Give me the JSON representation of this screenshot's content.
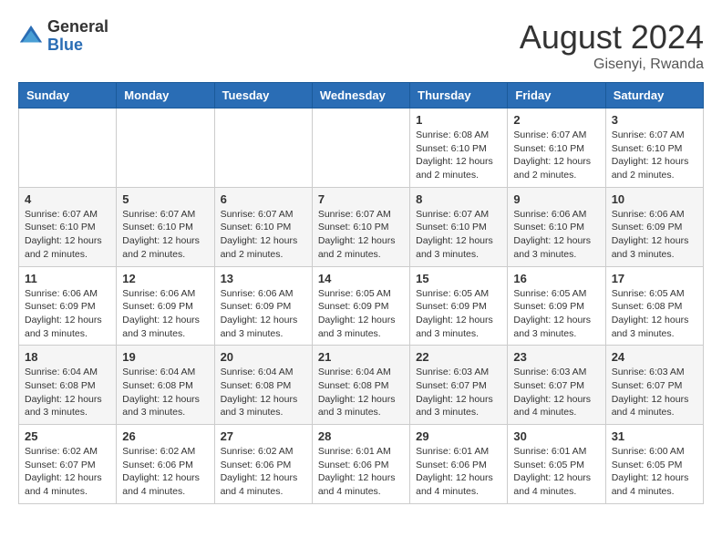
{
  "logo": {
    "general": "General",
    "blue": "Blue"
  },
  "title": "August 2024",
  "location": "Gisenyi, Rwanda",
  "days_of_week": [
    "Sunday",
    "Monday",
    "Tuesday",
    "Wednesday",
    "Thursday",
    "Friday",
    "Saturday"
  ],
  "weeks": [
    [
      {
        "day": "",
        "info": ""
      },
      {
        "day": "",
        "info": ""
      },
      {
        "day": "",
        "info": ""
      },
      {
        "day": "",
        "info": ""
      },
      {
        "day": "1",
        "info": "Sunrise: 6:08 AM\nSunset: 6:10 PM\nDaylight: 12 hours and 2 minutes."
      },
      {
        "day": "2",
        "info": "Sunrise: 6:07 AM\nSunset: 6:10 PM\nDaylight: 12 hours and 2 minutes."
      },
      {
        "day": "3",
        "info": "Sunrise: 6:07 AM\nSunset: 6:10 PM\nDaylight: 12 hours and 2 minutes."
      }
    ],
    [
      {
        "day": "4",
        "info": "Sunrise: 6:07 AM\nSunset: 6:10 PM\nDaylight: 12 hours and 2 minutes."
      },
      {
        "day": "5",
        "info": "Sunrise: 6:07 AM\nSunset: 6:10 PM\nDaylight: 12 hours and 2 minutes."
      },
      {
        "day": "6",
        "info": "Sunrise: 6:07 AM\nSunset: 6:10 PM\nDaylight: 12 hours and 2 minutes."
      },
      {
        "day": "7",
        "info": "Sunrise: 6:07 AM\nSunset: 6:10 PM\nDaylight: 12 hours and 2 minutes."
      },
      {
        "day": "8",
        "info": "Sunrise: 6:07 AM\nSunset: 6:10 PM\nDaylight: 12 hours and 3 minutes."
      },
      {
        "day": "9",
        "info": "Sunrise: 6:06 AM\nSunset: 6:10 PM\nDaylight: 12 hours and 3 minutes."
      },
      {
        "day": "10",
        "info": "Sunrise: 6:06 AM\nSunset: 6:09 PM\nDaylight: 12 hours and 3 minutes."
      }
    ],
    [
      {
        "day": "11",
        "info": "Sunrise: 6:06 AM\nSunset: 6:09 PM\nDaylight: 12 hours and 3 minutes."
      },
      {
        "day": "12",
        "info": "Sunrise: 6:06 AM\nSunset: 6:09 PM\nDaylight: 12 hours and 3 minutes."
      },
      {
        "day": "13",
        "info": "Sunrise: 6:06 AM\nSunset: 6:09 PM\nDaylight: 12 hours and 3 minutes."
      },
      {
        "day": "14",
        "info": "Sunrise: 6:05 AM\nSunset: 6:09 PM\nDaylight: 12 hours and 3 minutes."
      },
      {
        "day": "15",
        "info": "Sunrise: 6:05 AM\nSunset: 6:09 PM\nDaylight: 12 hours and 3 minutes."
      },
      {
        "day": "16",
        "info": "Sunrise: 6:05 AM\nSunset: 6:09 PM\nDaylight: 12 hours and 3 minutes."
      },
      {
        "day": "17",
        "info": "Sunrise: 6:05 AM\nSunset: 6:08 PM\nDaylight: 12 hours and 3 minutes."
      }
    ],
    [
      {
        "day": "18",
        "info": "Sunrise: 6:04 AM\nSunset: 6:08 PM\nDaylight: 12 hours and 3 minutes."
      },
      {
        "day": "19",
        "info": "Sunrise: 6:04 AM\nSunset: 6:08 PM\nDaylight: 12 hours and 3 minutes."
      },
      {
        "day": "20",
        "info": "Sunrise: 6:04 AM\nSunset: 6:08 PM\nDaylight: 12 hours and 3 minutes."
      },
      {
        "day": "21",
        "info": "Sunrise: 6:04 AM\nSunset: 6:08 PM\nDaylight: 12 hours and 3 minutes."
      },
      {
        "day": "22",
        "info": "Sunrise: 6:03 AM\nSunset: 6:07 PM\nDaylight: 12 hours and 3 minutes."
      },
      {
        "day": "23",
        "info": "Sunrise: 6:03 AM\nSunset: 6:07 PM\nDaylight: 12 hours and 4 minutes."
      },
      {
        "day": "24",
        "info": "Sunrise: 6:03 AM\nSunset: 6:07 PM\nDaylight: 12 hours and 4 minutes."
      }
    ],
    [
      {
        "day": "25",
        "info": "Sunrise: 6:02 AM\nSunset: 6:07 PM\nDaylight: 12 hours and 4 minutes."
      },
      {
        "day": "26",
        "info": "Sunrise: 6:02 AM\nSunset: 6:06 PM\nDaylight: 12 hours and 4 minutes."
      },
      {
        "day": "27",
        "info": "Sunrise: 6:02 AM\nSunset: 6:06 PM\nDaylight: 12 hours and 4 minutes."
      },
      {
        "day": "28",
        "info": "Sunrise: 6:01 AM\nSunset: 6:06 PM\nDaylight: 12 hours and 4 minutes."
      },
      {
        "day": "29",
        "info": "Sunrise: 6:01 AM\nSunset: 6:06 PM\nDaylight: 12 hours and 4 minutes."
      },
      {
        "day": "30",
        "info": "Sunrise: 6:01 AM\nSunset: 6:05 PM\nDaylight: 12 hours and 4 minutes."
      },
      {
        "day": "31",
        "info": "Sunrise: 6:00 AM\nSunset: 6:05 PM\nDaylight: 12 hours and 4 minutes."
      }
    ]
  ]
}
